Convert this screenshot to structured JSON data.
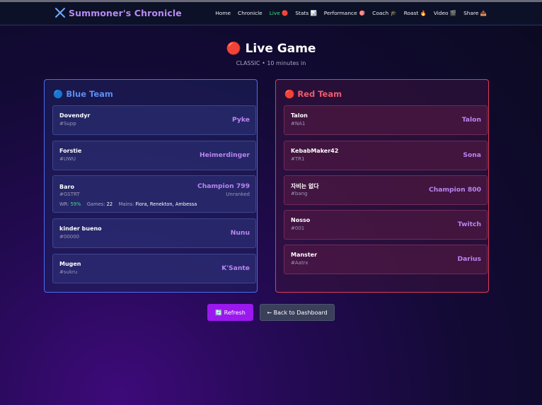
{
  "app": {
    "brand": "Summoner's Chronicle"
  },
  "nav": {
    "items": [
      {
        "label": "Home",
        "active": false
      },
      {
        "label": "Chronicle",
        "active": false
      },
      {
        "label": "Live 🔴",
        "active": true
      },
      {
        "label": "Stats 📊",
        "active": false
      },
      {
        "label": "Performance 🎯",
        "active": false
      },
      {
        "label": "Coach 🎓",
        "active": false
      },
      {
        "label": "Roast 🔥",
        "active": false
      },
      {
        "label": "Video 🎬",
        "active": false
      },
      {
        "label": "Share 📤",
        "active": false
      }
    ]
  },
  "page": {
    "title": "🔴 Live Game",
    "subtitle": "CLASSIC • 10 minutes in"
  },
  "blue_team": {
    "title": "🔵 Blue Team",
    "players": [
      {
        "name": "Dovendyr",
        "tag": "#Supp",
        "champion": "Pyke"
      },
      {
        "name": "Forstie",
        "tag": "#UWU",
        "champion": "Heimerdinger"
      },
      {
        "name": "Baro",
        "tag": "#GSTRT",
        "champion": "Champion 799",
        "rank": "Unranked",
        "stats": {
          "wr_label": "WR:",
          "wr": "59%",
          "games_label": "Games:",
          "games": "22",
          "mains_label": "Mains:",
          "mains": "Fiora, Renekton, Ambessa"
        }
      },
      {
        "name": "kinder bueno",
        "tag": "#00000",
        "champion": "Nunu"
      },
      {
        "name": "Mugen",
        "tag": "#sukru",
        "champion": "K'Sante"
      }
    ]
  },
  "red_team": {
    "title": "🔴 Red Team",
    "players": [
      {
        "name": "Talon",
        "tag": "#NA1",
        "champion": "Talon"
      },
      {
        "name": "KebabMaker42",
        "tag": "#TR1",
        "champion": "Sona"
      },
      {
        "name": "자비는 없다",
        "tag": "#bang",
        "champion": "Champion 800"
      },
      {
        "name": "Nosso",
        "tag": "#001",
        "champion": "Twitch"
      },
      {
        "name": "Manster",
        "tag": "#Aatrx",
        "champion": "Darius"
      }
    ]
  },
  "actions": {
    "refresh_label": "🔄 Refresh",
    "back_label": "← Back to Dashboard"
  },
  "colors": {
    "accent_purple": "#9b18ef",
    "blue_team": "#4d6cf0",
    "red_team": "#e23a59",
    "active_nav": "#3ddc84",
    "champion_text": "#b985f2"
  }
}
